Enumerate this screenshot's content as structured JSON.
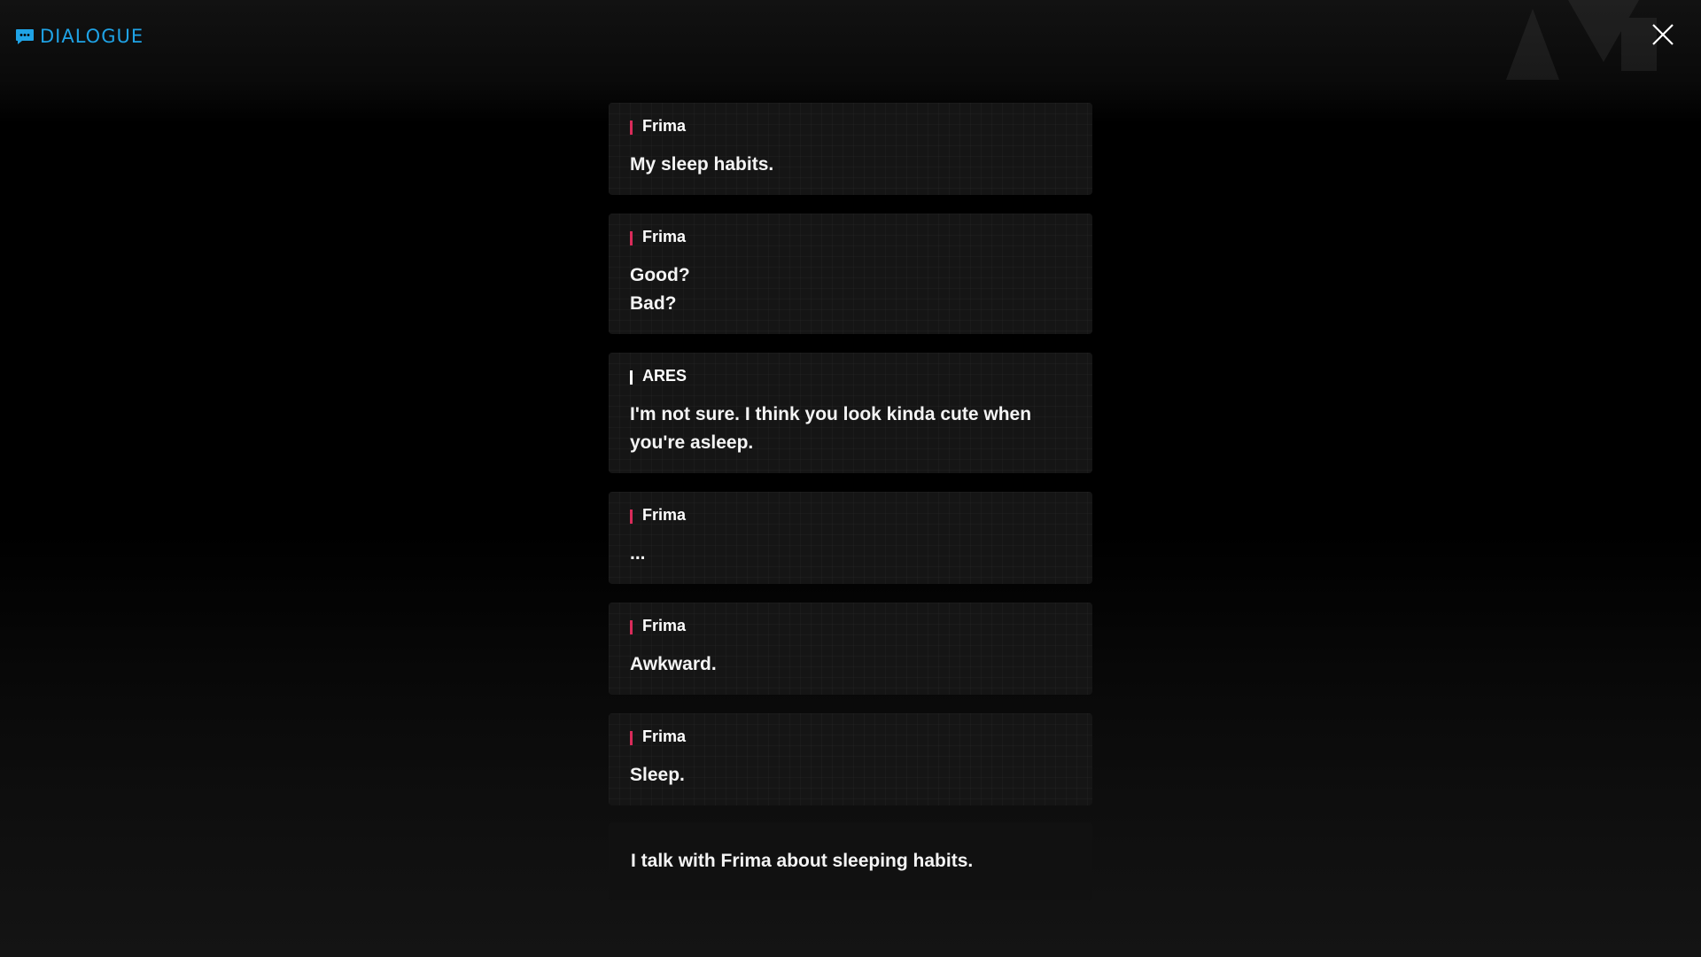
{
  "header": {
    "title": "DIALOGUE",
    "icon": "chat-bubble-icon",
    "accent_color": "#1fa3e6"
  },
  "close_icon": "close-icon",
  "speaker_colors": {
    "Frima": "#d92b5a",
    "ARES": "#ffffff"
  },
  "entries": [
    {
      "speaker": "Frima",
      "lines": [
        "My sleep habits."
      ]
    },
    {
      "speaker": "Frima",
      "lines": [
        "Good?",
        "Bad?"
      ]
    },
    {
      "speaker": "ARES",
      "lines": [
        "I'm not sure. I think you look kinda cute when you're asleep."
      ]
    },
    {
      "speaker": "Frima",
      "lines": [
        "..."
      ]
    },
    {
      "speaker": "Frima",
      "lines": [
        "Awkward."
      ]
    },
    {
      "speaker": "Frima",
      "lines": [
        "Sleep."
      ]
    }
  ],
  "summary": "I talk with Frima about sleeping habits."
}
